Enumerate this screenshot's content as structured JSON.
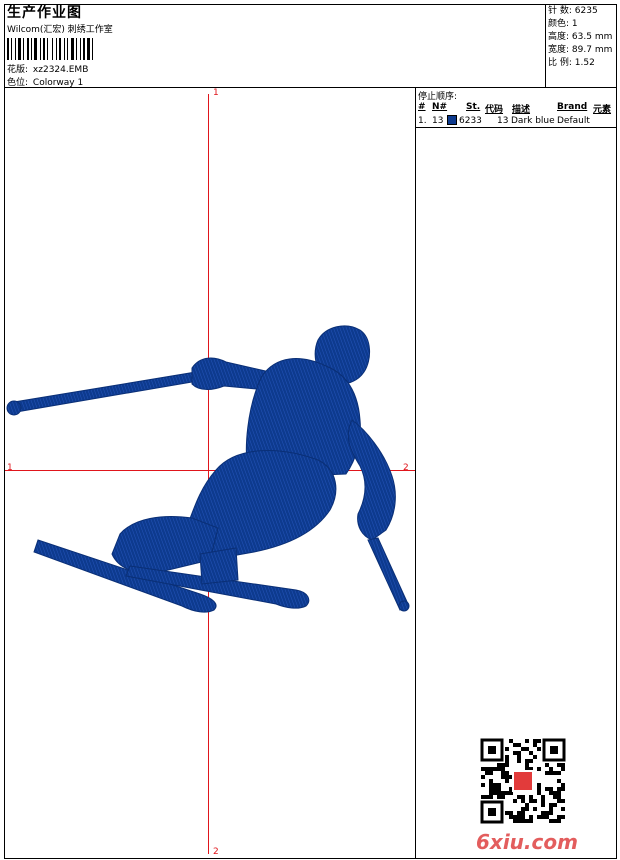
{
  "header": {
    "title": "生产作业图",
    "company": "Wilcom(汇宏) 刺绣工作室",
    "design_label": "花版:",
    "design_value": "xz2324.EMB",
    "colorway_label": "色位:",
    "colorway_value": "Colorway 1"
  },
  "stats": [
    {
      "label": "针 数:",
      "value": "6235"
    },
    {
      "label": "颜色:",
      "value": "1"
    },
    {
      "label": "高度:",
      "value": "63.5 mm"
    },
    {
      "label": "宽度:",
      "value": "89.7 mm"
    },
    {
      "label": "比 例:",
      "value": "1.52"
    }
  ],
  "stop_sequence": {
    "title": "停止顺序:",
    "columns": [
      "#",
      "N#",
      "St.",
      "代码",
      "描述",
      "Brand",
      "元素"
    ],
    "rows": [
      {
        "index": "1.",
        "needle": "13",
        "swatch_color": "#0d3a8e",
        "stitches": "6233",
        "code": "13",
        "description": "Dark blue",
        "brand": "Default",
        "element": ""
      }
    ]
  },
  "axes": {
    "top": "1",
    "left": "1",
    "right": "2",
    "bottom": "2"
  },
  "thread_color": "#0d3a8e",
  "axis_color": "#e0151b",
  "watermark": "6xiu.com"
}
